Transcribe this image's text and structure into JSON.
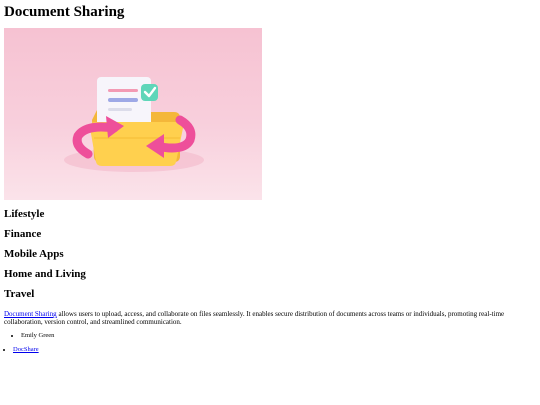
{
  "page": {
    "title": "Document Sharing"
  },
  "hero": {
    "icon": "folder-with-document-and-arrows-illustration",
    "background": "#f6c2d2"
  },
  "categories": [
    "Lifestyle",
    "Finance",
    "Mobile Apps",
    "Home and Living",
    "Travel"
  ],
  "description": {
    "link_text": "Document Sharing",
    "text": " allows users to upload, access, and collaborate on files seamlessly. It enables secure distribution of documents across teams or individuals, promoting real-time collaboration, version control, and streamlined communication."
  },
  "authors": [
    "Emily Green"
  ],
  "links": [
    "DocShare"
  ]
}
